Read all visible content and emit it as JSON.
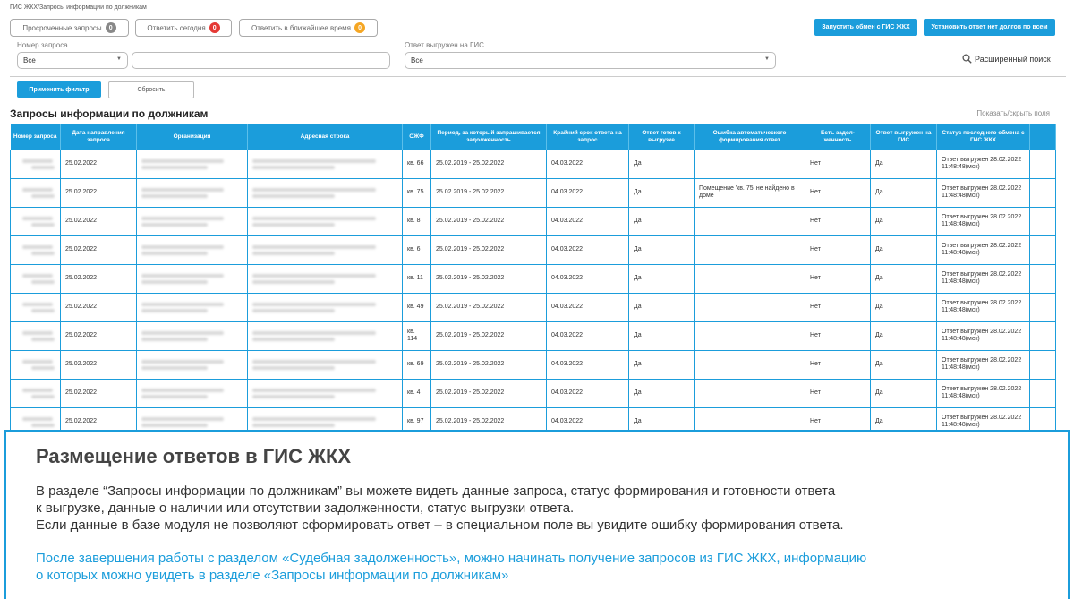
{
  "breadcrumb": "ГИС ЖКХ/Запросы информации по должникам",
  "quick_filters": [
    {
      "label": "Просроченные запросы",
      "count": "0",
      "badge_color": "#888888"
    },
    {
      "label": "Ответить сегодня",
      "count": "0",
      "badge_color": "#e53935"
    },
    {
      "label": "Ответить в ближайшее время",
      "count": "0",
      "badge_color": "#f5a623"
    }
  ],
  "actions": {
    "start_exchange": "Запустить обмен с ГИС ЖКХ",
    "set_no_debt": "Установить ответ нет долгов по всем"
  },
  "filters": {
    "request_number_label": "Номер запроса",
    "request_number_select": "Все",
    "request_number_value": "",
    "uploaded_label": "Ответ выгружен на ГИС",
    "uploaded_select": "Все",
    "advanced_search": "Расширенный поиск",
    "apply": "Применить фильтр",
    "reset": "Сбросить"
  },
  "section": {
    "title": "Запросы информации по должникам",
    "toggle_columns": "Показать/скрыть поля"
  },
  "table": {
    "headers": [
      "Номер запроса",
      "Дата направления запроса",
      "Организация",
      "Адресная строка",
      "ОЖФ",
      "Период, за который запрашивается задолженность",
      "Крайний срок ответа на запрос",
      "Ответ готов к выгрузке",
      "Ошибка автоматического формирования ответ",
      "Есть задол-женность",
      "Ответ выгружен на ГИС",
      "Статус последнего обмена с ГИС ЖКХ",
      ""
    ],
    "rows": [
      {
        "date": "25.02.2022",
        "ozhf": "кв. 66",
        "period": "25.02.2019 - 25.02.2022",
        "deadline": "04.03.2022",
        "ready": "Да",
        "error": "",
        "debt": "Нет",
        "uploaded": "Да",
        "status": "Ответ выгружен 28.02.2022 11:48:48(мск)"
      },
      {
        "date": "25.02.2022",
        "ozhf": "кв. 75",
        "period": "25.02.2019 - 25.02.2022",
        "deadline": "04.03.2022",
        "ready": "Да",
        "error": "Помещение 'кв. 75' не найдено в доме",
        "debt": "Нет",
        "uploaded": "Да",
        "status": "Ответ выгружен 28.02.2022 11:48:48(мск)"
      },
      {
        "date": "25.02.2022",
        "ozhf": "кв. 8",
        "period": "25.02.2019 - 25.02.2022",
        "deadline": "04.03.2022",
        "ready": "Да",
        "error": "",
        "debt": "Нет",
        "uploaded": "Да",
        "status": "Ответ выгружен 28.02.2022 11:48:48(мск)"
      },
      {
        "date": "25.02.2022",
        "ozhf": "кв. 6",
        "period": "25.02.2019 - 25.02.2022",
        "deadline": "04.03.2022",
        "ready": "Да",
        "error": "",
        "debt": "Нет",
        "uploaded": "Да",
        "status": "Ответ выгружен 28.02.2022 11:48:48(мск)"
      },
      {
        "date": "25.02.2022",
        "ozhf": "кв. 11",
        "period": "25.02.2019 - 25.02.2022",
        "deadline": "04.03.2022",
        "ready": "Да",
        "error": "",
        "debt": "Нет",
        "uploaded": "Да",
        "status": "Ответ выгружен 28.02.2022 11:48:48(мск)"
      },
      {
        "date": "25.02.2022",
        "ozhf": "кв. 49",
        "period": "25.02.2019 - 25.02.2022",
        "deadline": "04.03.2022",
        "ready": "Да",
        "error": "",
        "debt": "Нет",
        "uploaded": "Да",
        "status": "Ответ выгружен 28.02.2022 11:48:48(мск)"
      },
      {
        "date": "25.02.2022",
        "ozhf": "кв. 114",
        "period": "25.02.2019 - 25.02.2022",
        "deadline": "04.03.2022",
        "ready": "Да",
        "error": "",
        "debt": "Нет",
        "uploaded": "Да",
        "status": "Ответ выгружен 28.02.2022 11:48:48(мск)"
      },
      {
        "date": "25.02.2022",
        "ozhf": "кв. 69",
        "period": "25.02.2019 - 25.02.2022",
        "deadline": "04.03.2022",
        "ready": "Да",
        "error": "",
        "debt": "Нет",
        "uploaded": "Да",
        "status": "Ответ выгружен 28.02.2022 11:48:48(мск)"
      },
      {
        "date": "25.02.2022",
        "ozhf": "кв. 4",
        "period": "25.02.2019 - 25.02.2022",
        "deadline": "04.03.2022",
        "ready": "Да",
        "error": "",
        "debt": "Нет",
        "uploaded": "Да",
        "status": "Ответ выгружен 28.02.2022 11:48:48(мск)"
      },
      {
        "date": "25.02.2022",
        "ozhf": "кв. 97",
        "period": "25.02.2019 - 25.02.2022",
        "deadline": "04.03.2022",
        "ready": "Да",
        "error": "",
        "debt": "Нет",
        "uploaded": "Да",
        "status": "Ответ выгружен 28.02.2022 11:48:48(мск)"
      }
    ]
  },
  "info": {
    "title": "Размещение ответов в ГИС ЖКХ",
    "line1": "В разделе “Запросы информации по должникам” вы можете видеть данные запроса, статус формирования и готовности ответа",
    "line2": "к выгрузке, данные о наличии или отсутствии задолженности, статус выгрузки ответа.",
    "line3": "Если данные в базе модуля не позволяют сформировать ответ – в специальном поле вы увидите ошибку формирования ответа.",
    "link1": "После завершения работы с разделом «Судебная задолженность», можно начинать получение запросов из ГИС ЖКХ, информацию",
    "link2": "о которых можно увидеть в разделе «Запросы информации по должникам»"
  },
  "colors": {
    "accent": "#1b9ddb"
  }
}
